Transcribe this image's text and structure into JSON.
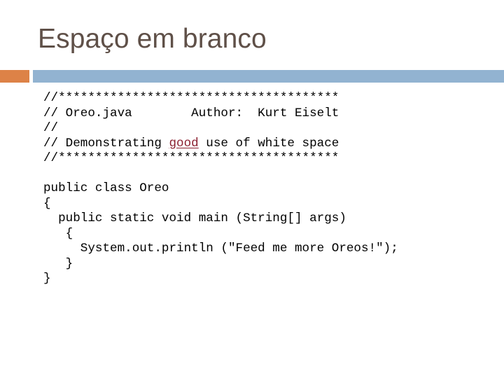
{
  "slide": {
    "title": "Espaço em branco",
    "title_color": "#5f5048",
    "background_color": "#ffffff"
  },
  "divider": {
    "accent_color": "#dd8247",
    "bar_color": "#92b3d1"
  },
  "code": {
    "language": "java",
    "text_color": "#000000",
    "flagged_word": "good",
    "flagged_color": "#8b2030",
    "lines": [
      {
        "id": "line-1",
        "pre": "//**************************************",
        "flagged": "",
        "post": ""
      },
      {
        "id": "line-2",
        "pre": "// Oreo.java        Author:  Kurt Eiselt",
        "flagged": "",
        "post": ""
      },
      {
        "id": "line-3",
        "pre": "//",
        "flagged": "",
        "post": ""
      },
      {
        "id": "line-4",
        "pre": "// Demonstrating ",
        "flagged": "good",
        "post": " use of white space"
      },
      {
        "id": "line-5",
        "pre": "//**************************************",
        "flagged": "",
        "post": ""
      },
      {
        "id": "line-6",
        "pre": "",
        "flagged": "",
        "post": ""
      },
      {
        "id": "line-7",
        "pre": "public class Oreo",
        "flagged": "",
        "post": ""
      },
      {
        "id": "line-8",
        "pre": "{",
        "flagged": "",
        "post": ""
      },
      {
        "id": "line-9",
        "pre": "  public static void main (String[] args)",
        "flagged": "",
        "post": ""
      },
      {
        "id": "line-10",
        "pre": "   {",
        "flagged": "",
        "post": ""
      },
      {
        "id": "line-11",
        "pre": "     System.out.println (\"Feed me more Oreos!\");",
        "flagged": "",
        "post": ""
      },
      {
        "id": "line-12",
        "pre": "   }",
        "flagged": "",
        "post": ""
      },
      {
        "id": "line-13",
        "pre": "}",
        "flagged": "",
        "post": ""
      }
    ]
  }
}
